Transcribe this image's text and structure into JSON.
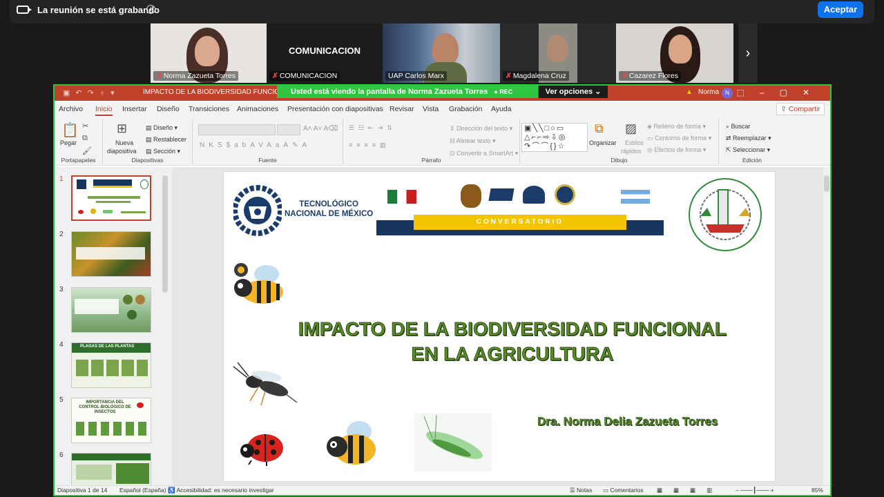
{
  "meeting": {
    "recording_text": "La reunión se está grabando",
    "accept_label": "Aceptar",
    "participants": [
      "Norma Zazueta Torres",
      "COMUNICACION",
      "UAP Carlos Marx",
      "Magdalena Cruz",
      "Cazarez Flores"
    ],
    "center_label": "COMUNICACION"
  },
  "share": {
    "banner_prefix": "Usted está viendo la pantalla de",
    "presenter": "Norma Zazueta Torres",
    "rec_badge": "REC",
    "view_options": "Ver opciones"
  },
  "ppt": {
    "doc_title": "IMPACTO DE LA BIODIVERSIDAD FUNCIONAL EN",
    "user": "Norma",
    "user_initial": "N",
    "tabs": [
      "Archivo",
      "Inicio",
      "Insertar",
      "Diseño",
      "Transiciones",
      "Animaciones",
      "Presentación con diapositivas",
      "Revisar",
      "Vista",
      "Grabación",
      "Ayuda"
    ],
    "share_label": "Compartir",
    "ribbon": {
      "paste": "Pegar",
      "clipboard": "Portapapeles",
      "new_slide": "Nueva",
      "new_slide2": "diapositiva",
      "layout": "Diseño",
      "reset": "Restablecer",
      "section": "Sección",
      "slides_group": "Diapositivas",
      "font_group": "Fuente",
      "paragraph_group": "Párrafo",
      "text_direction": "Dirección del texto",
      "align_text": "Alinear texto",
      "smartart": "Convertir a SmartArt",
      "organize": "Organizar",
      "quick_styles": "Estilos",
      "quick_styles2": "rápidos",
      "shape_fill": "Relleno de forma",
      "shape_outline": "Contorno de forma",
      "shape_effects": "Efectos de forma",
      "drawing_group": "Dibujo",
      "find": "Buscar",
      "replace": "Reemplazar",
      "select": "Seleccionar",
      "editing_group": "Edición"
    },
    "thumb_numbers": [
      "1",
      "2",
      "3",
      "4",
      "5",
      "6"
    ],
    "thumb_4_title": "PLAGAS DE LAS PLANTAS",
    "thumb_5_title": "IMPORTANCIA DEL CONTROL BIOLÓGICO DE INSECTOS",
    "slide": {
      "org_name_1": "TECNOLÓGICO",
      "org_name_2": "NACIONAL DE MÉXICO",
      "banner_word": "CONVERSATORIO",
      "title_line1": "IMPACTO DE LA BIODIVERSIDAD FUNCIONAL",
      "title_line2": "EN LA AGRICULTURA",
      "author": "Dra. Norma Delia Zazueta Torres"
    },
    "status": {
      "slide_count": "Diapositiva 1 de 14",
      "language": "Español (España)",
      "accessibility": "Accesibilidad: es necesario investigar",
      "notes": "Notas",
      "comments": "Comentarios",
      "zoom": "85%"
    }
  }
}
